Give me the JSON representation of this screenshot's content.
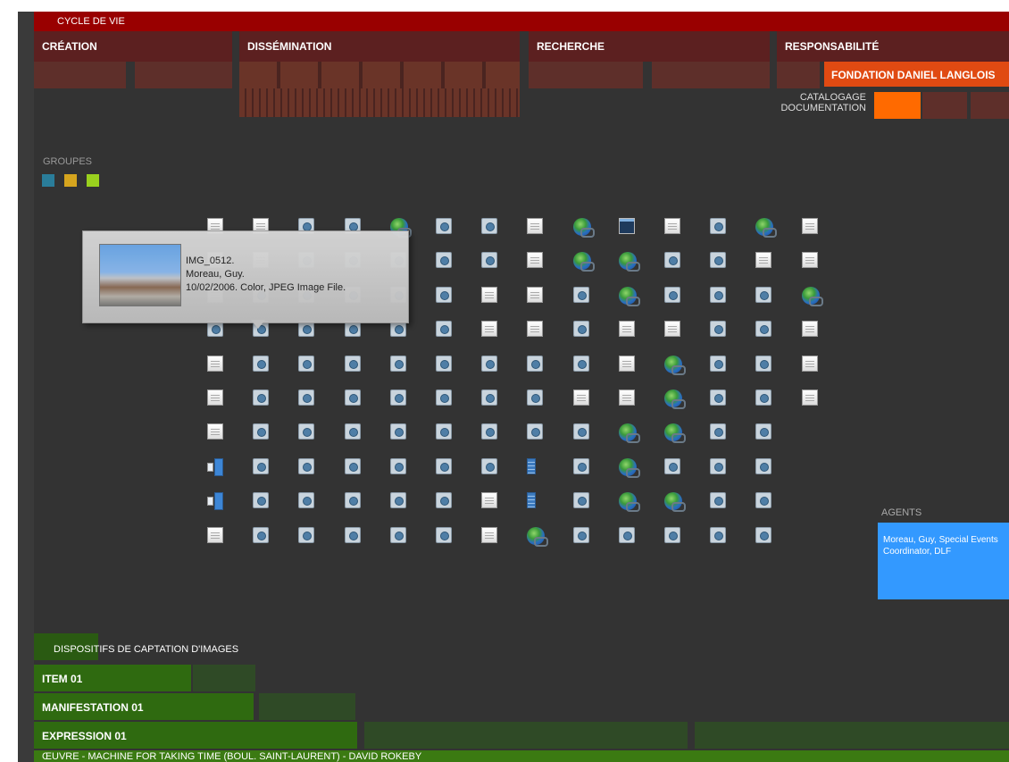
{
  "header": {
    "title": "CYCLE DE VIE"
  },
  "categories": [
    {
      "label": "CRÉATION"
    },
    {
      "label": "DISSÉMINATION"
    },
    {
      "label": "RECHERCHE"
    },
    {
      "label": "RESPONSABILITÉ"
    }
  ],
  "fondation": {
    "label": "FONDATION DANIEL LANGLOIS"
  },
  "catalogage": {
    "line1": "CATALOGAGE",
    "line2": "DOCUMENTATION"
  },
  "groups": {
    "label": "GROUPES",
    "colors": [
      "#2a7d9a",
      "#d6a51e",
      "#9ad11e"
    ]
  },
  "icon_grid": {
    "rows": [
      [
        "doc",
        "doc",
        "cam",
        "cam",
        "globe",
        "cam",
        "cam",
        "doc",
        "globe",
        "term",
        "doc",
        "cam",
        "globe",
        "doc"
      ],
      [
        "doc",
        "doc",
        "cam",
        "cam",
        "cam",
        "cam",
        "cam",
        "doc",
        "globe",
        "globe",
        "cam",
        "cam",
        "doc",
        "doc"
      ],
      [
        "doc",
        "cam",
        "cam",
        "cam",
        "cam",
        "cam",
        "doc",
        "doc",
        "cam",
        "globe",
        "cam",
        "cam",
        "cam",
        "globe"
      ],
      [
        "cam",
        "cam",
        "cam",
        "cam",
        "cam",
        "cam",
        "doc",
        "doc",
        "cam",
        "doc",
        "doc",
        "cam",
        "cam",
        "doc"
      ],
      [
        "doc",
        "cam",
        "cam",
        "cam",
        "cam",
        "cam",
        "cam",
        "cam",
        "cam",
        "doc",
        "globe",
        "cam",
        "cam",
        "doc"
      ],
      [
        "doc",
        "cam",
        "cam",
        "cam",
        "cam",
        "cam",
        "cam",
        "cam",
        "doc",
        "doc",
        "globe",
        "cam",
        "cam",
        "doc"
      ],
      [
        "doc",
        "cam",
        "cam",
        "cam",
        "cam",
        "cam",
        "cam",
        "cam",
        "cam",
        "globe",
        "globe",
        "cam",
        "cam",
        ""
      ],
      [
        "book",
        "cam",
        "cam",
        "cam",
        "cam",
        "cam",
        "cam",
        "film",
        "cam",
        "globe",
        "cam",
        "cam",
        "cam",
        ""
      ],
      [
        "book",
        "cam",
        "cam",
        "cam",
        "cam",
        "cam",
        "doc",
        "film",
        "cam",
        "globe",
        "globe",
        "cam",
        "cam",
        ""
      ],
      [
        "doc",
        "cam",
        "cam",
        "cam",
        "cam",
        "cam",
        "doc",
        "globe",
        "cam",
        "cam",
        "cam",
        "cam",
        "cam",
        ""
      ]
    ]
  },
  "tooltip": {
    "line1": "IMG_0512.",
    "line2": "Moreau, Guy.",
    "line3": "10/02/2006. Color, JPEG Image File."
  },
  "agents": {
    "label": "AGENTS",
    "entry": "Moreau, Guy, Special Events Coordinator, DLF"
  },
  "bottom": {
    "dispositifs": "DISPOSITIFS DE CAPTATION D'IMAGES",
    "item": "ITEM 01",
    "manifestation": "MANIFESTATION 01",
    "expression": "EXPRESSION 01",
    "oeuvre": "ŒUVRE - MACHINE FOR TAKING TIME (BOUL. SAINT-LAURENT) - DAVID ROKEBY"
  },
  "colors": {
    "header_red": "#990000",
    "fondation_orange": "#e04a12",
    "catalog_orange": "#ff6a00",
    "agents_blue": "#3399ff",
    "green": "#2f6a10"
  }
}
